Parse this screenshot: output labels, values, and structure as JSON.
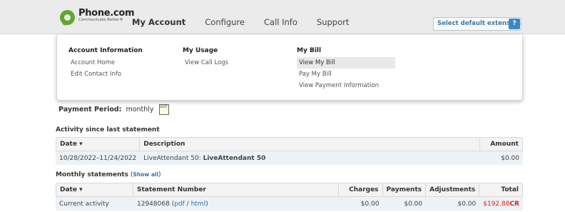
{
  "logo": {
    "name": "Phone.com",
    "tagline": "Communicate Better®"
  },
  "nav": {
    "items": [
      {
        "label": "My Account",
        "active": true
      },
      {
        "label": "Configure",
        "active": false
      },
      {
        "label": "Call Info",
        "active": false
      },
      {
        "label": "Support",
        "active": false
      }
    ]
  },
  "extension_button": {
    "label": "Select default extension",
    "help": "?"
  },
  "dropdown": {
    "account": {
      "heading": "Account Information",
      "links": [
        "Account Home",
        "Edit Contact Info"
      ]
    },
    "usage": {
      "heading": "My Usage",
      "links": [
        "View Call Logs"
      ]
    },
    "bill": {
      "heading": "My Bill",
      "links": [
        "View My Bill",
        "Pay My Bill",
        "View Payment Information"
      ]
    }
  },
  "payment_period": {
    "label": "Payment Period:",
    "value": "monthly",
    "edit_icon_text": "EDIT"
  },
  "activity": {
    "title": "Activity since last statement",
    "columns": {
      "date": "Date ▾",
      "description": "Description",
      "amount": "Amount"
    },
    "rows": [
      {
        "date": "10/28/2022–11/24/2022",
        "desc_prefix": "LiveAttendant 50: ",
        "desc_bold": "LiveAttendant 50",
        "amount": "$0.00"
      }
    ]
  },
  "statements": {
    "title": "Monthly statements",
    "open_paren": " (",
    "show_all": "Show all",
    "close_paren": ")",
    "columns": {
      "date": "Date ▾",
      "number": "Statement Number",
      "charges": "Charges",
      "payments": "Payments",
      "adjustments": "Adjustments",
      "total": "Total"
    },
    "rows": [
      {
        "date": "Current activity",
        "number": "12948068",
        "pdf": "pdf",
        "sep": " / ",
        "html": "html",
        "charges": "$0.00",
        "payments": "$0.00",
        "adjustments": "$0.00",
        "total": "$192.88",
        "total_suffix": "CR"
      }
    ]
  },
  "colors": {
    "brand_green": "#63a531",
    "link_blue": "#2a73b0",
    "credit_red": "#e0201b"
  }
}
